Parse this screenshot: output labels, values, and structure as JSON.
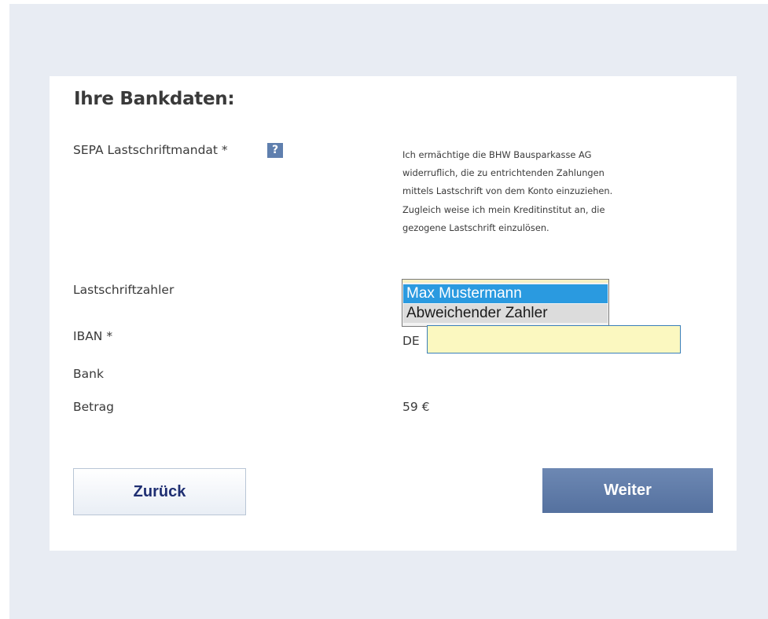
{
  "form": {
    "title": "Ihre Bankdaten:",
    "mandate_label": "SEPA Lastschriftmandat *",
    "help_icon": "?",
    "mandate_text": [
      "Ich ermächtige die BHW Bausparkasse AG",
      "widerruflich, die zu entrichtenden Zahlungen",
      "mittels Lastschrift von dem Konto einzuziehen.",
      "Zugleich weise ich mein Kreditinstitut an, die",
      "gezogene Lastschrift einzulösen."
    ],
    "payer_label": "Lastschriftzahler",
    "payer_options": [
      "Max Mustermann",
      "Abweichender Zahler"
    ],
    "payer_selected": "Max Mustermann",
    "iban_label": "IBAN *",
    "iban_prefix": "DE",
    "iban_value": "",
    "bank_label": "Bank",
    "amount_label": "Betrag",
    "amount_value": "59 €"
  },
  "buttons": {
    "back_label": "Zurück",
    "next_label": "Weiter"
  },
  "colors": {
    "page_background": "#e8ecf3",
    "card_background": "#ffffff",
    "help_icon": "#5f7fae",
    "selected_option": "#2a9ae0",
    "iban_field": "#fbf8c0",
    "next_button": "#5f7ba8",
    "back_button_text": "#1f2f72"
  }
}
